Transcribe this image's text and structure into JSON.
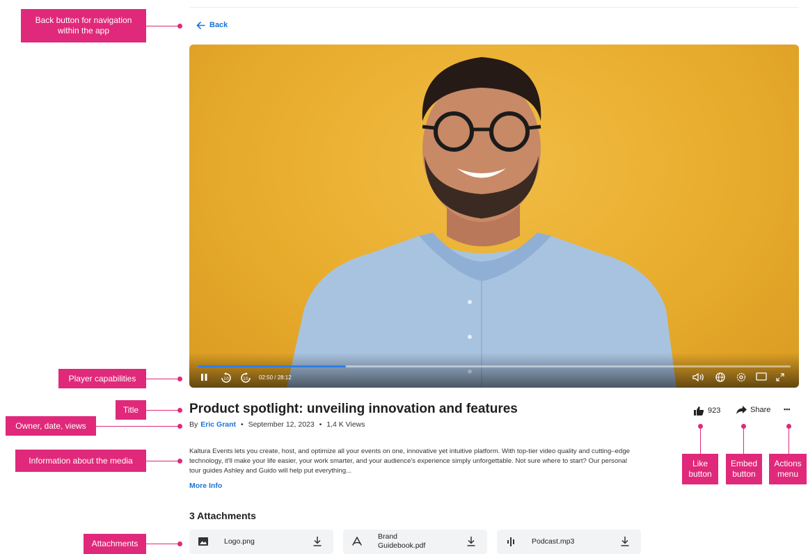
{
  "back": {
    "label": "Back"
  },
  "player": {
    "time": "02:50 / 28:12",
    "progress": 0.25
  },
  "media": {
    "title": "Product spotlight: unveiling innovation and features",
    "by": "By",
    "owner": "Eric Grant",
    "date": "September 12, 2023",
    "views": "1,4 K Views",
    "description": "Kaltura Events lets you create, host, and optimize all your events on one, innovative yet intuitive platform. With top-tier video quality and cutting–edge technology, it'll make your life easier, your work smarter, and your audience's experience simply unforgettable. Not sure where to start? Our personal tour guides Ashley and Guido will help put everything...",
    "more_info": "More Info"
  },
  "actions": {
    "likes": "923",
    "share": "Share",
    "more": "•••"
  },
  "attachments": {
    "heading": "3 Attachments",
    "items": [
      {
        "name": "Logo.png",
        "icon": "image-icon"
      },
      {
        "name": "Brand Guidebook.pdf",
        "icon": "pdf-icon"
      },
      {
        "name": "Podcast.mp3",
        "icon": "audio-icon"
      }
    ]
  },
  "callouts": {
    "back": "Back button for navigation within the app",
    "player": "Player capabilities",
    "title": "Title",
    "owner": "Owner, date, views",
    "info": "Information about the media",
    "attachments": "Attachments",
    "like": "Like button",
    "embed": "Embed button",
    "actions": "Actions menu"
  },
  "colors": {
    "accent": "#1a73d9",
    "callout": "#e0297a",
    "progress": "#2f7fe6"
  }
}
